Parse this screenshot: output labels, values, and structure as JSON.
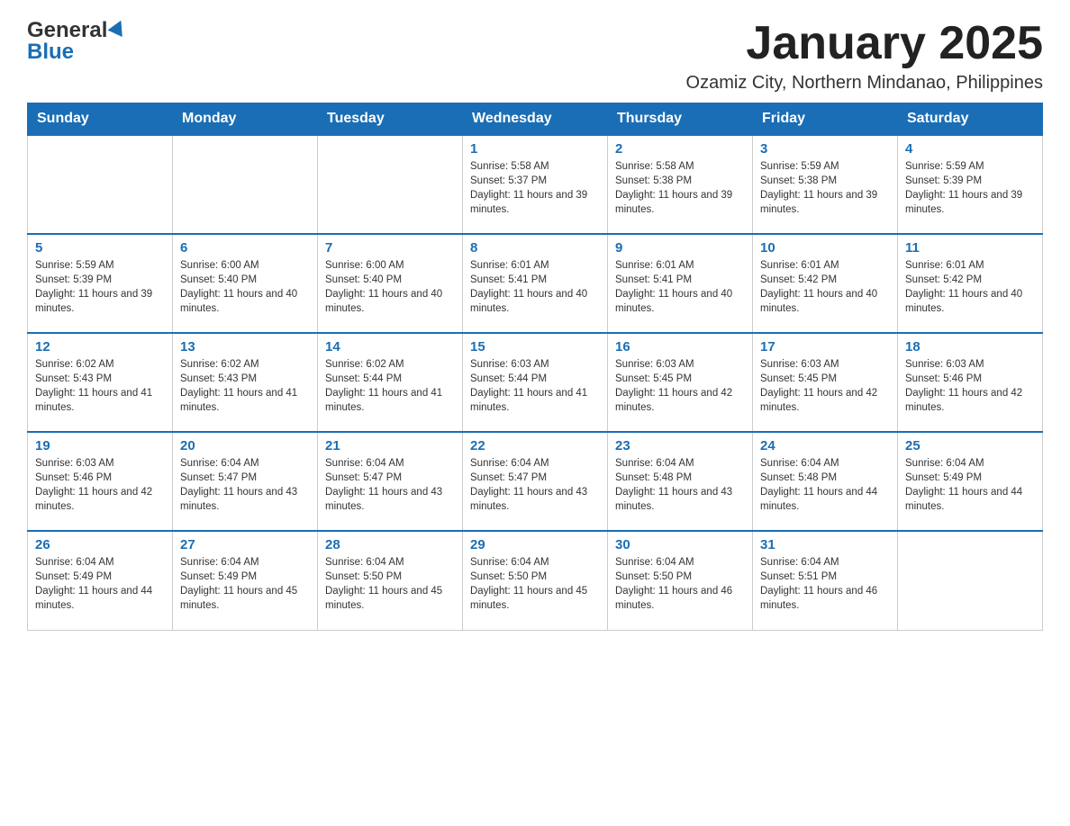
{
  "header": {
    "logo": {
      "general": "General",
      "blue": "Blue"
    },
    "month_title": "January 2025",
    "subtitle": "Ozamiz City, Northern Mindanao, Philippines"
  },
  "weekdays": [
    "Sunday",
    "Monday",
    "Tuesday",
    "Wednesday",
    "Thursday",
    "Friday",
    "Saturday"
  ],
  "weeks": [
    [
      {
        "day": "",
        "sunrise": "",
        "sunset": "",
        "daylight": ""
      },
      {
        "day": "",
        "sunrise": "",
        "sunset": "",
        "daylight": ""
      },
      {
        "day": "",
        "sunrise": "",
        "sunset": "",
        "daylight": ""
      },
      {
        "day": "1",
        "sunrise": "Sunrise: 5:58 AM",
        "sunset": "Sunset: 5:37 PM",
        "daylight": "Daylight: 11 hours and 39 minutes."
      },
      {
        "day": "2",
        "sunrise": "Sunrise: 5:58 AM",
        "sunset": "Sunset: 5:38 PM",
        "daylight": "Daylight: 11 hours and 39 minutes."
      },
      {
        "day": "3",
        "sunrise": "Sunrise: 5:59 AM",
        "sunset": "Sunset: 5:38 PM",
        "daylight": "Daylight: 11 hours and 39 minutes."
      },
      {
        "day": "4",
        "sunrise": "Sunrise: 5:59 AM",
        "sunset": "Sunset: 5:39 PM",
        "daylight": "Daylight: 11 hours and 39 minutes."
      }
    ],
    [
      {
        "day": "5",
        "sunrise": "Sunrise: 5:59 AM",
        "sunset": "Sunset: 5:39 PM",
        "daylight": "Daylight: 11 hours and 39 minutes."
      },
      {
        "day": "6",
        "sunrise": "Sunrise: 6:00 AM",
        "sunset": "Sunset: 5:40 PM",
        "daylight": "Daylight: 11 hours and 40 minutes."
      },
      {
        "day": "7",
        "sunrise": "Sunrise: 6:00 AM",
        "sunset": "Sunset: 5:40 PM",
        "daylight": "Daylight: 11 hours and 40 minutes."
      },
      {
        "day": "8",
        "sunrise": "Sunrise: 6:01 AM",
        "sunset": "Sunset: 5:41 PM",
        "daylight": "Daylight: 11 hours and 40 minutes."
      },
      {
        "day": "9",
        "sunrise": "Sunrise: 6:01 AM",
        "sunset": "Sunset: 5:41 PM",
        "daylight": "Daylight: 11 hours and 40 minutes."
      },
      {
        "day": "10",
        "sunrise": "Sunrise: 6:01 AM",
        "sunset": "Sunset: 5:42 PM",
        "daylight": "Daylight: 11 hours and 40 minutes."
      },
      {
        "day": "11",
        "sunrise": "Sunrise: 6:01 AM",
        "sunset": "Sunset: 5:42 PM",
        "daylight": "Daylight: 11 hours and 40 minutes."
      }
    ],
    [
      {
        "day": "12",
        "sunrise": "Sunrise: 6:02 AM",
        "sunset": "Sunset: 5:43 PM",
        "daylight": "Daylight: 11 hours and 41 minutes."
      },
      {
        "day": "13",
        "sunrise": "Sunrise: 6:02 AM",
        "sunset": "Sunset: 5:43 PM",
        "daylight": "Daylight: 11 hours and 41 minutes."
      },
      {
        "day": "14",
        "sunrise": "Sunrise: 6:02 AM",
        "sunset": "Sunset: 5:44 PM",
        "daylight": "Daylight: 11 hours and 41 minutes."
      },
      {
        "day": "15",
        "sunrise": "Sunrise: 6:03 AM",
        "sunset": "Sunset: 5:44 PM",
        "daylight": "Daylight: 11 hours and 41 minutes."
      },
      {
        "day": "16",
        "sunrise": "Sunrise: 6:03 AM",
        "sunset": "Sunset: 5:45 PM",
        "daylight": "Daylight: 11 hours and 42 minutes."
      },
      {
        "day": "17",
        "sunrise": "Sunrise: 6:03 AM",
        "sunset": "Sunset: 5:45 PM",
        "daylight": "Daylight: 11 hours and 42 minutes."
      },
      {
        "day": "18",
        "sunrise": "Sunrise: 6:03 AM",
        "sunset": "Sunset: 5:46 PM",
        "daylight": "Daylight: 11 hours and 42 minutes."
      }
    ],
    [
      {
        "day": "19",
        "sunrise": "Sunrise: 6:03 AM",
        "sunset": "Sunset: 5:46 PM",
        "daylight": "Daylight: 11 hours and 42 minutes."
      },
      {
        "day": "20",
        "sunrise": "Sunrise: 6:04 AM",
        "sunset": "Sunset: 5:47 PM",
        "daylight": "Daylight: 11 hours and 43 minutes."
      },
      {
        "day": "21",
        "sunrise": "Sunrise: 6:04 AM",
        "sunset": "Sunset: 5:47 PM",
        "daylight": "Daylight: 11 hours and 43 minutes."
      },
      {
        "day": "22",
        "sunrise": "Sunrise: 6:04 AM",
        "sunset": "Sunset: 5:47 PM",
        "daylight": "Daylight: 11 hours and 43 minutes."
      },
      {
        "day": "23",
        "sunrise": "Sunrise: 6:04 AM",
        "sunset": "Sunset: 5:48 PM",
        "daylight": "Daylight: 11 hours and 43 minutes."
      },
      {
        "day": "24",
        "sunrise": "Sunrise: 6:04 AM",
        "sunset": "Sunset: 5:48 PM",
        "daylight": "Daylight: 11 hours and 44 minutes."
      },
      {
        "day": "25",
        "sunrise": "Sunrise: 6:04 AM",
        "sunset": "Sunset: 5:49 PM",
        "daylight": "Daylight: 11 hours and 44 minutes."
      }
    ],
    [
      {
        "day": "26",
        "sunrise": "Sunrise: 6:04 AM",
        "sunset": "Sunset: 5:49 PM",
        "daylight": "Daylight: 11 hours and 44 minutes."
      },
      {
        "day": "27",
        "sunrise": "Sunrise: 6:04 AM",
        "sunset": "Sunset: 5:49 PM",
        "daylight": "Daylight: 11 hours and 45 minutes."
      },
      {
        "day": "28",
        "sunrise": "Sunrise: 6:04 AM",
        "sunset": "Sunset: 5:50 PM",
        "daylight": "Daylight: 11 hours and 45 minutes."
      },
      {
        "day": "29",
        "sunrise": "Sunrise: 6:04 AM",
        "sunset": "Sunset: 5:50 PM",
        "daylight": "Daylight: 11 hours and 45 minutes."
      },
      {
        "day": "30",
        "sunrise": "Sunrise: 6:04 AM",
        "sunset": "Sunset: 5:50 PM",
        "daylight": "Daylight: 11 hours and 46 minutes."
      },
      {
        "day": "31",
        "sunrise": "Sunrise: 6:04 AM",
        "sunset": "Sunset: 5:51 PM",
        "daylight": "Daylight: 11 hours and 46 minutes."
      },
      {
        "day": "",
        "sunrise": "",
        "sunset": "",
        "daylight": ""
      }
    ]
  ]
}
